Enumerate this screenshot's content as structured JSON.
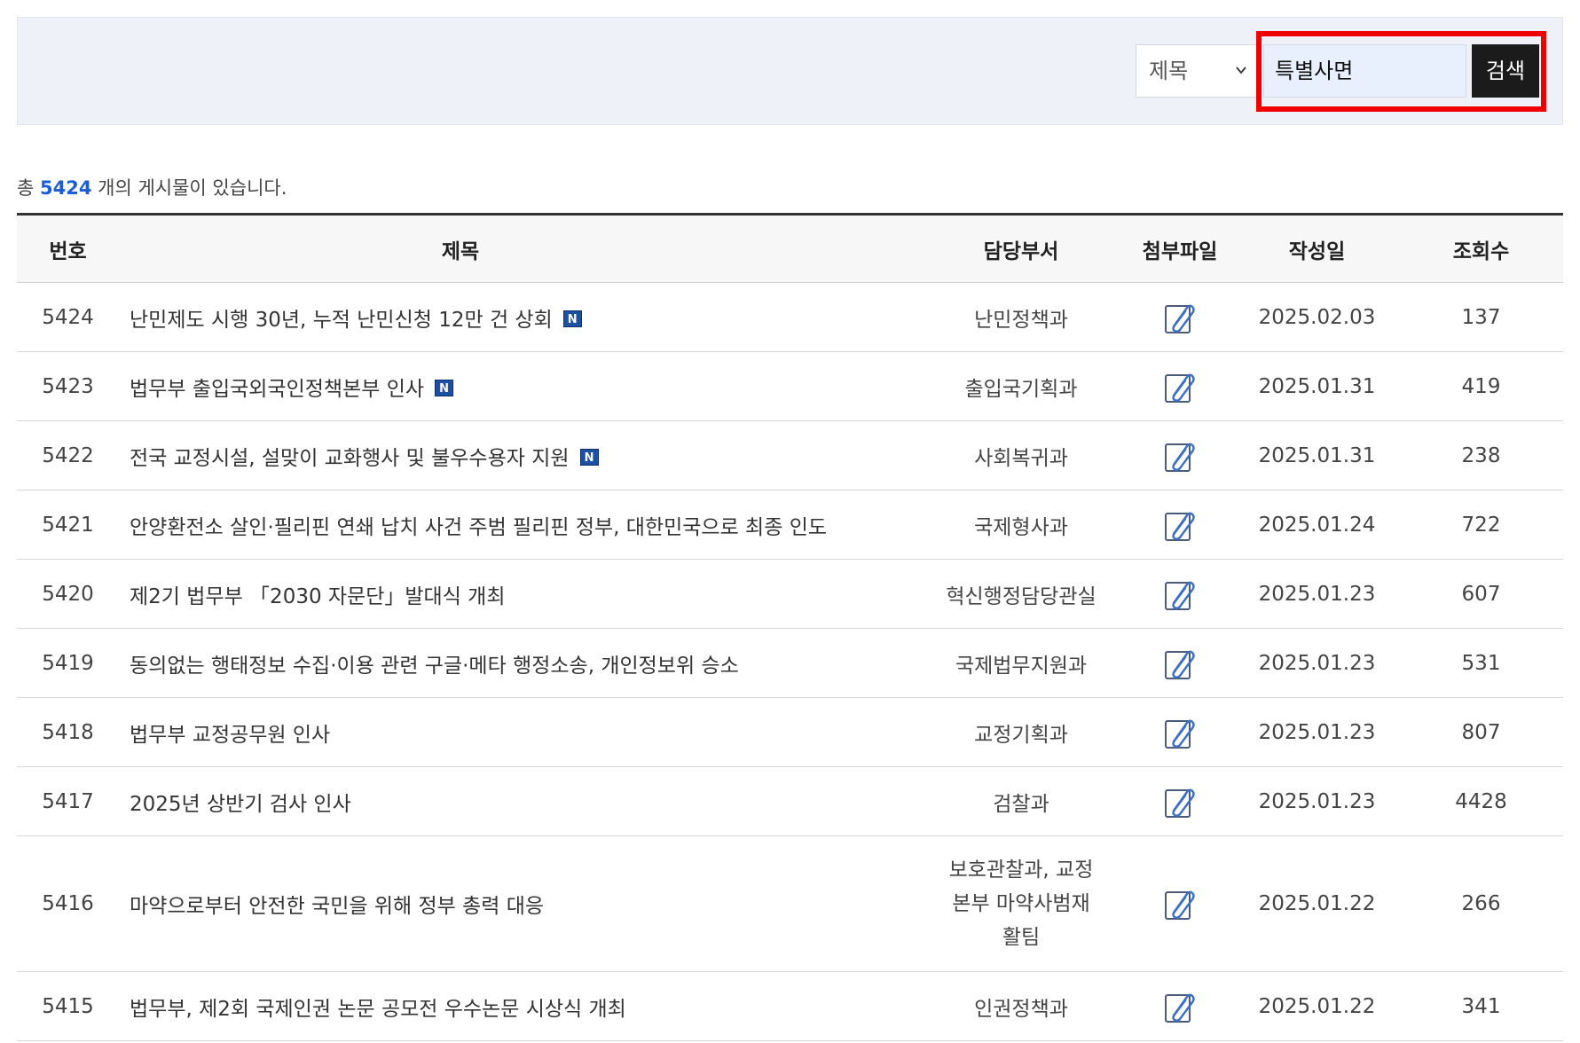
{
  "search": {
    "field_selected": "제목",
    "query": "특별사면",
    "button_label": "검색"
  },
  "summary": {
    "prefix": "총",
    "count": "5424",
    "suffix": "개의 게시물이 있습니다."
  },
  "table": {
    "headers": {
      "no": "번호",
      "title": "제목",
      "dept": "담당부서",
      "attach": "첨부파일",
      "date": "작성일",
      "views": "조회수"
    },
    "new_badge_label": "N",
    "rows": [
      {
        "no": "5424",
        "title": "난민제도 시행 30년, 누적 난민신청 12만 건 상회",
        "dept": "난민정책과",
        "date": "2025.02.03",
        "views": "137"
      },
      {
        "no": "5423",
        "title": "법무부 출입국외국인정책본부 인사",
        "dept": "출입국기획과",
        "date": "2025.01.31",
        "views": "419"
      },
      {
        "no": "5422",
        "title": "전국 교정시설, 설맞이 교화행사 및 불우수용자 지원",
        "dept": "사회복귀과",
        "date": "2025.01.31",
        "views": "238"
      },
      {
        "no": "5421",
        "title": "안양환전소 살인·필리핀 연쇄 납치 사건 주범 필리핀 정부, 대한민국으로 최종 인도",
        "dept": "국제형사과",
        "date": "2025.01.24",
        "views": "722"
      },
      {
        "no": "5420",
        "title": "제2기 법무부 「2030 자문단」발대식 개최",
        "dept": "혁신행정담당관실",
        "date": "2025.01.23",
        "views": "607"
      },
      {
        "no": "5419",
        "title": "동의없는 행태정보 수집·이용 관련 구글·메타 행정소송, 개인정보위 승소",
        "dept": "국제법무지원과",
        "date": "2025.01.23",
        "views": "531"
      },
      {
        "no": "5418",
        "title": "법무부 교정공무원 인사",
        "dept": "교정기획과",
        "date": "2025.01.23",
        "views": "807"
      },
      {
        "no": "5417",
        "title": "2025년 상반기 검사 인사",
        "dept": "검찰과",
        "date": "2025.01.23",
        "views": "4428"
      },
      {
        "no": "5416",
        "title": "마약으로부터 안전한 국민을 위해 정부 총력 대응",
        "dept_lines": [
          "보호관찰과, 교정",
          "본부 마약사범재",
          "활팀"
        ],
        "date": "2025.01.22",
        "views": "266"
      },
      {
        "no": "5415",
        "title": "법무부, 제2회 국제인권 논문 공모전 우수논문 시상식 개최",
        "dept": "인권정책과",
        "date": "2025.01.22",
        "views": "341"
      }
    ]
  },
  "icons": {
    "attachment": "paperclip-document-icon",
    "select_arrow": "chevron-down-icon"
  },
  "colors": {
    "panel_bg": "#eef1f7",
    "button_bg": "#1b1b1b",
    "count_accent": "#1c5ed6",
    "highlight": "#ee0000",
    "badge_bg": "#1d4fa3"
  }
}
